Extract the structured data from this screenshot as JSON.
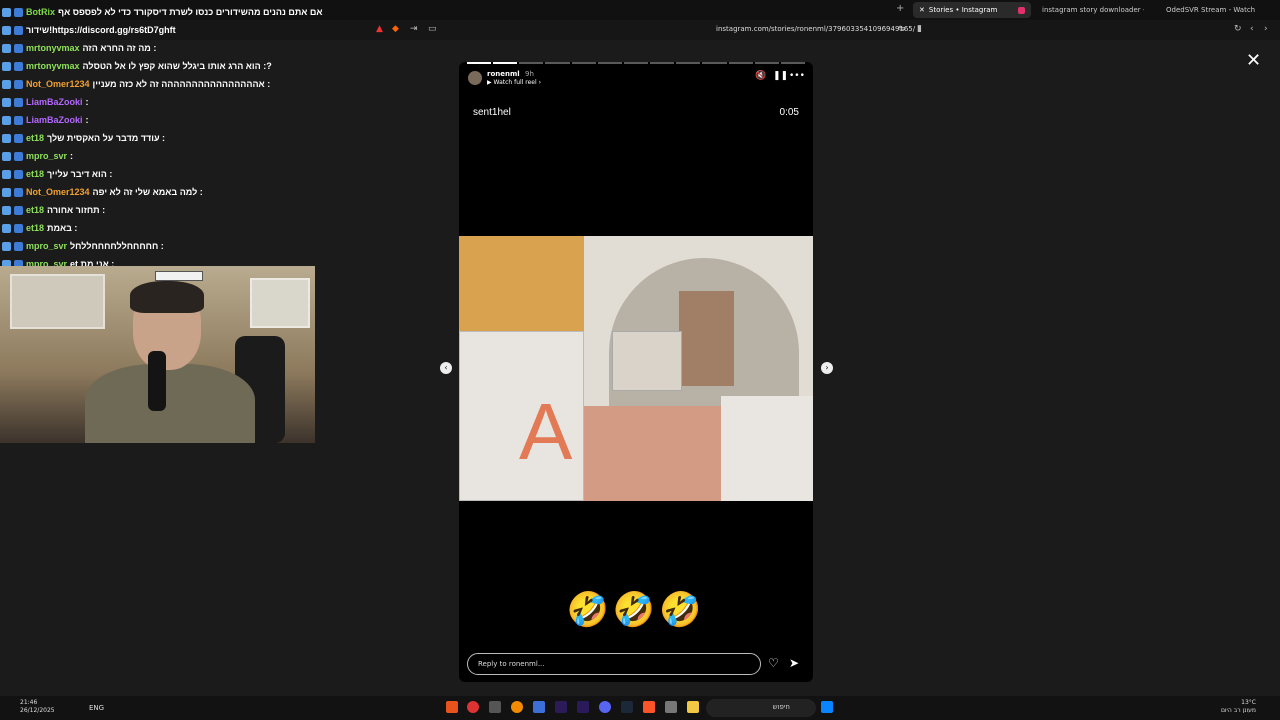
{
  "browser": {
    "tabs": [
      {
        "label": "Stories • Instagram",
        "active": true
      },
      {
        "label": "instagram story downloader - Googl",
        "active": false
      },
      {
        "label": "OdedSVR Stream - Watch Live o",
        "active": false
      }
    ],
    "new_tab": "+",
    "url": "instagram.com/stories/ronenml/3796033541096949165/"
  },
  "chat": {
    "messages": [
      {
        "user": "BotRix",
        "color": "#7fdc4a",
        "text": "אם אתם נהנים מהשידורים כנסו לשרת דיסקורד כדי לא לפספס אף"
      },
      {
        "user": "",
        "color": "#ffffff",
        "text": "שידור!https://discord.gg/rs6tD7ghft"
      },
      {
        "user": "mrtonyvmax",
        "color": "#8ee05a",
        "text": "מה זה החרא הזה :"
      },
      {
        "user": "mrtonyvmax",
        "color": "#8ee05a",
        "text": "הוא הרג אותו ביגלל שהוא קפץ לו אל הטסלה :?"
      },
      {
        "user": "Not_Omer1234",
        "color": "#f0a030",
        "text": "אהההההההההההההההה זה לא כזה מעניין :"
      },
      {
        "user": "LiamBaZooki",
        "color": "#b468ff",
        "text": ":"
      },
      {
        "user": "LiamBaZooki",
        "color": "#b468ff",
        "text": ":"
      },
      {
        "user": "et18",
        "color": "#8ee05a",
        "text": "עודד מדבר על האקסית שלך :"
      },
      {
        "user": "mpro_svr",
        "color": "#8ee05a",
        "text": ":"
      },
      {
        "user": "et18",
        "color": "#8ee05a",
        "text": "הוא דיבר עלייך :"
      },
      {
        "user": "Not_Omer1234",
        "color": "#f0a030",
        "text": "למה באמא שלי זה לא יפה :"
      },
      {
        "user": "et18",
        "color": "#8ee05a",
        "text": "תחזור אחורה :"
      },
      {
        "user": "et18",
        "color": "#8ee05a",
        "text": "באמת :"
      },
      {
        "user": "mpro_svr",
        "color": "#8ee05a",
        "text": "חחחחחללחחחחללחל :"
      },
      {
        "user": "mpro_svr",
        "color": "#8ee05a",
        "text": "et אני מת :"
      }
    ]
  },
  "story": {
    "username": "ronenml",
    "time_ago": "9h",
    "subtitle": "Watch full reel",
    "name": "sent1hel",
    "clock": "0:05",
    "emojis": "🤣🤣🤣",
    "reply_placeholder": "Reply to ronenml...",
    "scene_letter": "A"
  },
  "close_label": "✕",
  "taskbar": {
    "time": "21:46",
    "date": "26/12/2025",
    "lang": "ENG",
    "search": "חיפוש",
    "weather_temp": "13°C",
    "weather_desc": "מעונן רב היום"
  }
}
